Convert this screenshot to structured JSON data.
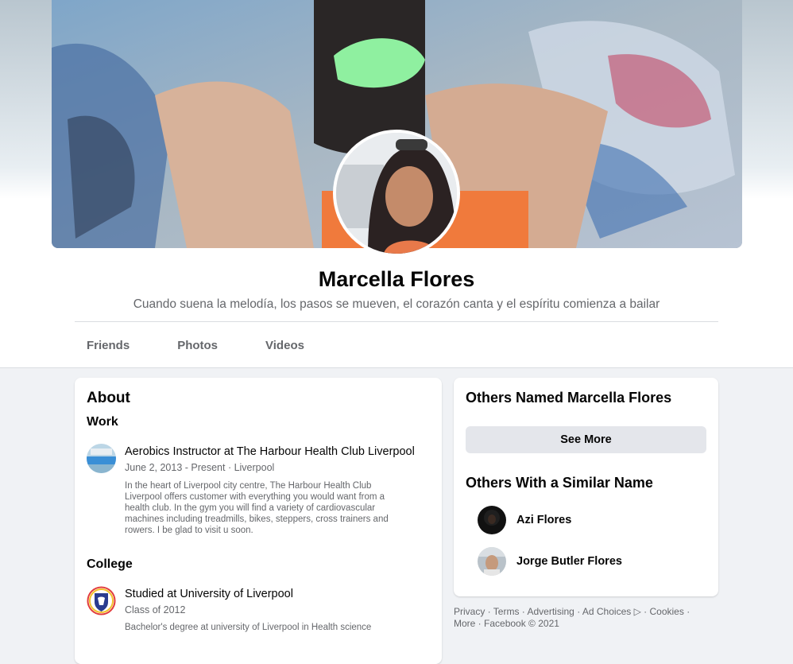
{
  "profile": {
    "name": "Marcella Flores",
    "bio": "Cuando suena la melodía, los pasos se mueven, el corazón canta y el espíritu comienza a bailar"
  },
  "tabs": [
    {
      "label": "Friends"
    },
    {
      "label": "Photos"
    },
    {
      "label": "Videos"
    }
  ],
  "about": {
    "title": "About",
    "work": {
      "heading": "Work",
      "title": "Aerobics Instructor at The Harbour Health Club Liverpool",
      "dates": "June 2, 2013 - Present · Liverpool",
      "description": "In the heart of Liverpool city centre, The Harbour Health Club Liverpool offers customer with everything you would want from a health club. In the gym you will find a variety of cardiovascular machines including treadmills, bikes, steppers, cross trainers and rowers. I be glad to visit u soon."
    },
    "college": {
      "heading": "College",
      "title": "Studied at University of Liverpool",
      "class": "Class of 2012",
      "degree": "Bachelor's degree at university of Liverpool in Health science"
    }
  },
  "sidebar": {
    "others_named_title": "Others Named Marcella Flores",
    "see_more_label": "See More",
    "similar_title": "Others With a Similar Name",
    "people": [
      {
        "name": "Azi Flores"
      },
      {
        "name": "Jorge Butler Flores"
      }
    ]
  },
  "footer": {
    "privacy": "Privacy",
    "terms": "Terms",
    "advertising": "Advertising",
    "ad_choices": "Ad Choices",
    "cookies": "Cookies",
    "more": "More",
    "copyright": "Facebook © 2021"
  },
  "colors": {
    "background": "#f0f2f5",
    "secondary_text": "#65676b",
    "button_bg": "#e4e6eb"
  }
}
